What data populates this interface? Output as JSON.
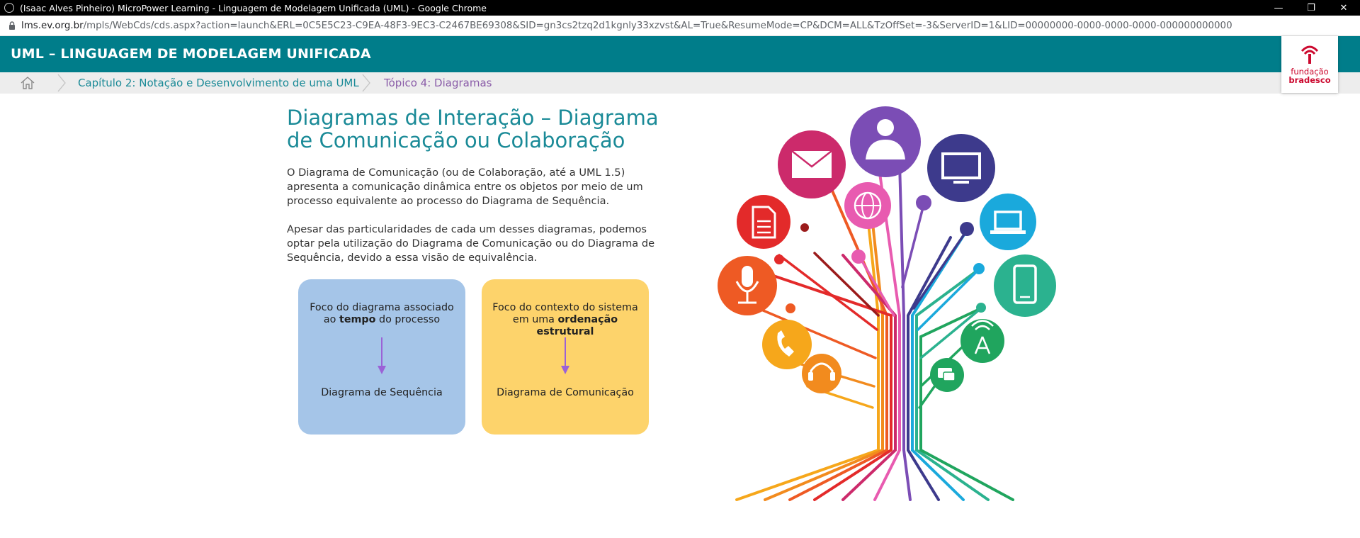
{
  "browser": {
    "window_title": "(Isaac Alves Pinheiro) MicroPower Learning - Linguagem de Modelagem Unificada (UML) - Google Chrome",
    "url_host": "lms.ev.org.br",
    "url_path": "/mpls/WebCds/cds.aspx?action=launch&ERL=0C5E5C23-C9EA-48F3-9EC3-C2467BE69308&SID=gn3cs2tzq2d1kgnly33xzvst&AL=True&ResumeMode=CP&DCM=ALL&TzOffSet=-3&ServerID=1&LID=00000000-0000-0000-0000-000000000000",
    "controls": {
      "minimize": "—",
      "restore": "❐",
      "close": "✕"
    }
  },
  "header": {
    "title": "UML – LINGUAGEM DE MODELAGEM UNIFICADA",
    "logo_line1": "fundação",
    "logo_line2": "bradesco"
  },
  "breadcrumb": {
    "items": [
      {
        "label": "Capítulo 2: Notação e Desenvolvimento de uma UML"
      },
      {
        "label": "Tópico 4: Diagramas"
      }
    ]
  },
  "content": {
    "title": "Diagramas de Interação – Diagrama de Comunicação ou Colaboração",
    "paragraph1": "O Diagrama de Comunicação (ou de Colaboração, até a UML 1.5) apresenta a comunicação dinâmica entre os objetos por meio de um processo equivalente ao processo do Diagrama de Sequência.",
    "paragraph2": "Apesar das particularidades de cada um desses diagramas, podemos optar pela utilização do Diagrama de Comunicação ou do Diagrama de Sequência, devido a essa visão de equivalência.",
    "cards": [
      {
        "top_pre": "Foco do diagrama associado ao ",
        "top_bold": "tempo",
        "top_post": " do processo",
        "bottom": "Diagrama de Sequência"
      },
      {
        "top_pre": "Foco do contexto do sistema em uma ",
        "top_bold": "ordenação estrutural",
        "top_post": "",
        "bottom": "Diagrama de Comunicação"
      }
    ]
  },
  "illustration": {
    "icons": [
      "user-icon",
      "email-icon",
      "monitor-icon",
      "globe-icon",
      "document-icon",
      "laptop-icon",
      "microphone-icon",
      "smartphone-icon",
      "antenna-icon",
      "phone-icon",
      "headset-icon",
      "chat-icon"
    ],
    "colors": {
      "purple": "#7b4db5",
      "magenta": "#cc2a6b",
      "navy": "#3d3a8c",
      "pink": "#e85bb0",
      "red": "#e32a2a",
      "cyan": "#1aa9dc",
      "orange": "#ee5a24",
      "teal": "#2bb28f",
      "green": "#20a55e",
      "yellow": "#f6a71b",
      "amber": "#f28b1e",
      "darkred": "#9b1b1b"
    }
  },
  "colors": {
    "accent": "#007d8a",
    "crumb_active": "#8a5ca8",
    "card_blue": "#a5c5e8",
    "card_yellow": "#fdd36b",
    "arrow": "#9b62d6"
  }
}
